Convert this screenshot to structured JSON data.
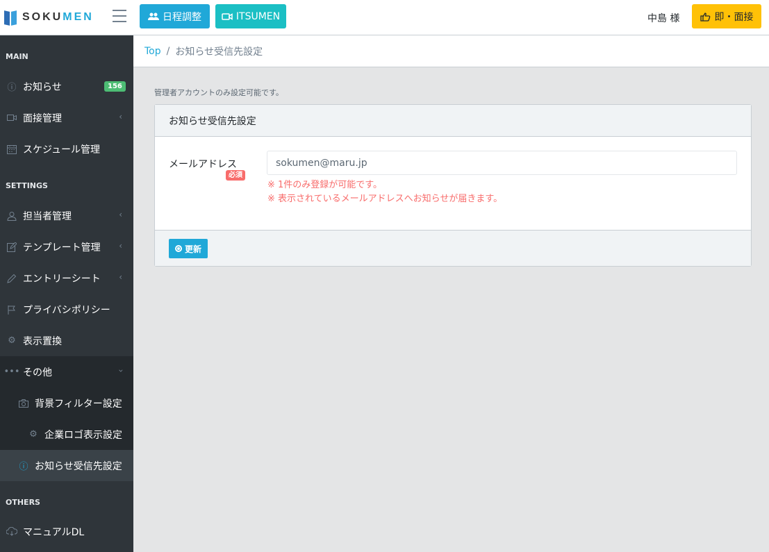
{
  "header": {
    "brand": "SOKUMEN",
    "schedule_button": "日程調整",
    "itsumen_button": "ITSUMEN",
    "user_name": "中島 様",
    "sokumen_button": "即・面接"
  },
  "sidebar": {
    "sections": {
      "main": "MAIN",
      "settings": "SETTINGS",
      "others": "OTHERS"
    },
    "items": {
      "notices": {
        "label": "お知らせ",
        "badge": "156",
        "icon": "info-icon"
      },
      "interview": {
        "label": "面接管理",
        "icon": "video-icon"
      },
      "schedule": {
        "label": "スケジュール管理",
        "icon": "calendar-icon"
      },
      "staff": {
        "label": "担当者管理",
        "icon": "user-icon"
      },
      "template": {
        "label": "テンプレート管理",
        "icon": "edit-icon"
      },
      "entry_sheet": {
        "label": "エントリーシート",
        "icon": "pencil-icon"
      },
      "privacy": {
        "label": "プライバシポリシー",
        "icon": "flag-icon"
      },
      "display_replace": {
        "label": "表示置換",
        "icon": "gear-icon"
      },
      "other": {
        "label": "その他",
        "icon": "dots-icon"
      },
      "bg_filter": {
        "label": "背景フィルター設定",
        "icon": "camera-icon"
      },
      "company_logo": {
        "label": "企業ロゴ表示設定",
        "icon": "gear-icon"
      },
      "notice_recipient": {
        "label": "お知らせ受信先設定",
        "icon": "info-icon"
      },
      "manual": {
        "label": "マニュアルDL",
        "icon": "cloud-download-icon"
      }
    }
  },
  "breadcrumb": {
    "top": "Top",
    "current": "お知らせ受信先設定"
  },
  "main": {
    "admin_note": "管理者アカウントのみ設定可能です。",
    "card_title": "お知らせ受信先設定",
    "email_label": "メールアドレス",
    "required_badge": "必須",
    "email_value": "sokumen@maru.jp",
    "note1": "※ 1件のみ登録が可能です。",
    "note2": "※ 表示されているメールアドレスへお知らせが届きます。",
    "update_button": "更新"
  },
  "colors": {
    "primary": "#20a8d8",
    "teal": "#1bbfc4",
    "warning": "#ffc107",
    "danger": "#f86c6b",
    "success": "#4dbd74",
    "sidebar_bg": "#2f353a"
  }
}
